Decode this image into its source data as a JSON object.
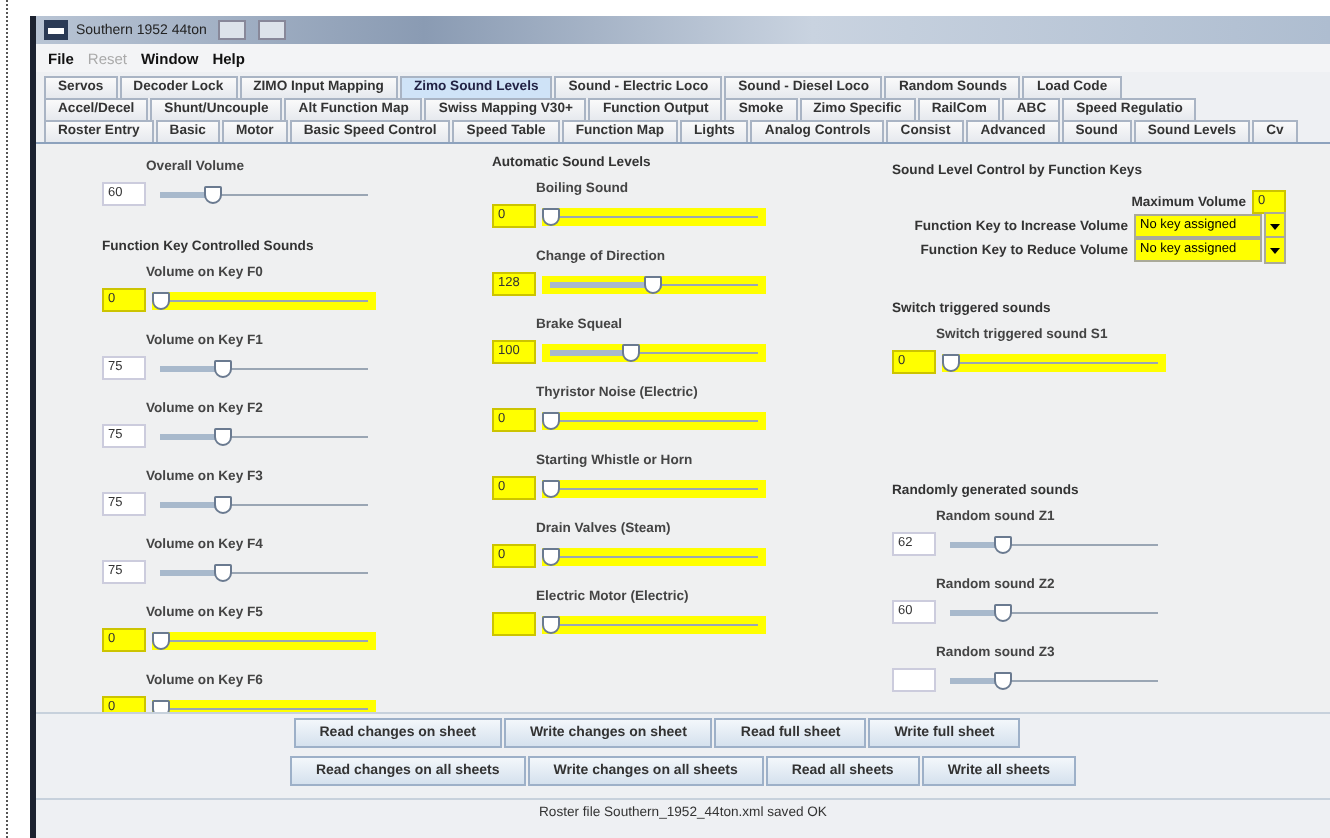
{
  "window": {
    "title": "Southern 1952 44ton"
  },
  "menu": [
    {
      "label": "File",
      "disabled": false
    },
    {
      "label": "Reset",
      "disabled": true
    },
    {
      "label": "Window",
      "disabled": false
    },
    {
      "label": "Help",
      "disabled": false
    }
  ],
  "tab_rows": [
    [
      {
        "label": "Servos",
        "selected": false
      },
      {
        "label": "Decoder Lock",
        "selected": false
      },
      {
        "label": "ZIMO Input Mapping",
        "selected": false
      },
      {
        "label": "Zimo Sound Levels",
        "selected": true
      },
      {
        "label": "Sound - Electric Loco",
        "selected": false
      },
      {
        "label": "Sound - Diesel Loco",
        "selected": false
      },
      {
        "label": "Random Sounds",
        "selected": false
      },
      {
        "label": "Load Code",
        "selected": false
      }
    ],
    [
      {
        "label": "Accel/Decel",
        "selected": false
      },
      {
        "label": "Shunt/Uncouple",
        "selected": false
      },
      {
        "label": "Alt Function Map",
        "selected": false
      },
      {
        "label": "Swiss Mapping V30+",
        "selected": false
      },
      {
        "label": "Function Output",
        "selected": false
      },
      {
        "label": "Smoke",
        "selected": false
      },
      {
        "label": "Zimo Specific",
        "selected": false
      },
      {
        "label": "RailCom",
        "selected": false
      },
      {
        "label": "ABC",
        "selected": false
      },
      {
        "label": "Speed Regulatio",
        "selected": false
      }
    ],
    [
      {
        "label": "Roster Entry",
        "selected": false
      },
      {
        "label": "Basic",
        "selected": false
      },
      {
        "label": "Motor",
        "selected": false
      },
      {
        "label": "Basic Speed Control",
        "selected": false
      },
      {
        "label": "Speed Table",
        "selected": false
      },
      {
        "label": "Function Map",
        "selected": false
      },
      {
        "label": "Lights",
        "selected": false
      },
      {
        "label": "Analog Controls",
        "selected": false
      },
      {
        "label": "Consist",
        "selected": false
      },
      {
        "label": "Advanced",
        "selected": false
      },
      {
        "label": "Sound",
        "selected": false
      },
      {
        "label": "Sound Levels",
        "selected": false
      },
      {
        "label": "Cv",
        "selected": false
      }
    ]
  ],
  "columns": [
    {
      "sections": [
        {
          "items": [
            {
              "kind": "slider",
              "label": "Overall Volume",
              "value": "60",
              "level": 0.25,
              "highlighted": false
            }
          ]
        },
        {
          "title": "Function Key Controlled Sounds",
          "items": [
            {
              "kind": "slider",
              "label": "Volume on Key F0",
              "value": "0",
              "level": 0,
              "highlighted": true
            },
            {
              "kind": "slider",
              "label": "Volume on Key F1",
              "value": "75",
              "level": 0.3,
              "highlighted": false
            },
            {
              "kind": "slider",
              "label": "Volume on Key F2",
              "value": "75",
              "level": 0.3,
              "highlighted": false
            },
            {
              "kind": "slider",
              "label": "Volume on Key F3",
              "value": "75",
              "level": 0.3,
              "highlighted": false
            },
            {
              "kind": "slider",
              "label": "Volume on Key F4",
              "value": "75",
              "level": 0.3,
              "highlighted": false
            },
            {
              "kind": "slider",
              "label": "Volume on Key F5",
              "value": "0",
              "level": 0,
              "highlighted": true
            },
            {
              "kind": "slider",
              "label": "Volume on Key F6",
              "value": "0",
              "level": 0,
              "highlighted": true
            }
          ]
        }
      ]
    },
    {
      "sections": [
        {
          "title": "Automatic Sound Levels",
          "items": [
            {
              "kind": "slider",
              "label": "Boiling Sound",
              "value": "0",
              "level": 0,
              "highlighted": true
            },
            {
              "kind": "slider",
              "label": "Change of Direction",
              "value": "128",
              "level": 0.5,
              "highlighted": true
            },
            {
              "kind": "slider",
              "label": "Brake Squeal",
              "value": "100",
              "level": 0.39,
              "highlighted": true
            },
            {
              "kind": "slider",
              "label": "Thyristor Noise (Electric)",
              "value": "0",
              "level": 0,
              "highlighted": true
            },
            {
              "kind": "slider",
              "label": "Starting Whistle or Horn",
              "value": "0",
              "level": 0,
              "highlighted": true
            },
            {
              "kind": "slider",
              "label": "Drain Valves (Steam)",
              "value": "0",
              "level": 0,
              "highlighted": true
            },
            {
              "kind": "slider",
              "label": "Electric Motor (Electric)",
              "level": 0,
              "highlighted": true
            }
          ]
        }
      ]
    },
    {
      "sections": [
        {
          "title": "Sound Level Control by Function Keys",
          "items": [
            {
              "kind": "field",
              "label": "Maximum Volume",
              "value": "0",
              "highlighted": true
            },
            {
              "kind": "combo",
              "label": "Function Key to Increase Volume",
              "value": "No key assigned",
              "highlighted": true
            },
            {
              "kind": "combo",
              "label": "Function Key to Reduce Volume",
              "value": "No key assigned",
              "highlighted": true
            }
          ]
        },
        {
          "title": "Switch triggered sounds",
          "items": [
            {
              "kind": "slider",
              "label": "Switch triggered sound S1",
              "value": "0",
              "level": 0,
              "highlighted": true
            }
          ]
        },
        {
          "title": "Randomly generated sounds",
          "items": [
            {
              "kind": "slider",
              "label": "Random sound Z1",
              "value": "62",
              "level": 0.25,
              "highlighted": false
            },
            {
              "kind": "slider",
              "label": "Random sound Z2",
              "value": "60",
              "level": 0.25,
              "highlighted": false
            },
            {
              "kind": "slider",
              "label": "Random sound Z3",
              "level": 0.25,
              "highlighted": false
            }
          ]
        }
      ]
    }
  ],
  "button_rows": [
    [
      "Read changes on sheet",
      "Write changes on sheet",
      "Read full sheet",
      "Write full sheet"
    ],
    [
      "Read changes on all sheets",
      "Write changes on all sheets",
      "Read all sheets",
      "Write all sheets"
    ]
  ],
  "status_bar": "Roster file Southern_1952_44ton.xml saved OK"
}
